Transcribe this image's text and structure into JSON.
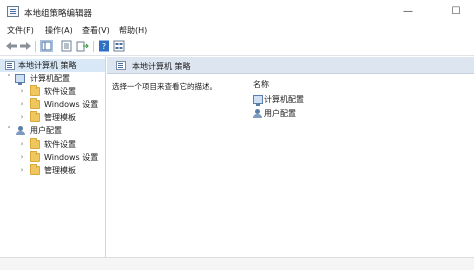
{
  "window": {
    "title": "本地组策略编辑器",
    "minimize_glyph": "—",
    "maximize_glyph": "☐"
  },
  "menu": [
    {
      "label": "文件(F)"
    },
    {
      "label": "操作(A)"
    },
    {
      "label": "查看(V)"
    },
    {
      "label": "帮助(H)"
    }
  ],
  "toolbar": {
    "buttons": [
      "back-icon",
      "forward-icon",
      "show-hide-tree-icon",
      "properties-icon",
      "export-list-icon",
      "help-icon",
      "view-icon"
    ]
  },
  "tree": {
    "root": {
      "label": "本地计算机 策略"
    },
    "computer_config": {
      "label": "计算机配置"
    },
    "computer_children": [
      {
        "label": "软件设置"
      },
      {
        "label": "Windows 设置"
      },
      {
        "label": "管理模板"
      }
    ],
    "user_config": {
      "label": "用户配置"
    },
    "user_children": [
      {
        "label": "软件设置"
      },
      {
        "label": "Windows 设置"
      },
      {
        "label": "管理模板"
      }
    ]
  },
  "detail": {
    "header_title": "本地计算机 策略",
    "description": "选择一个项目来查看它的描述。",
    "column_name": "名称",
    "items": [
      {
        "label": "计算机配置",
        "icon": "computer-icon"
      },
      {
        "label": "用户配置",
        "icon": "user-icon"
      }
    ]
  },
  "colors": {
    "selection": "#d9e8f7",
    "header_band": "#dde6f0",
    "folder": "#f0c75e"
  }
}
